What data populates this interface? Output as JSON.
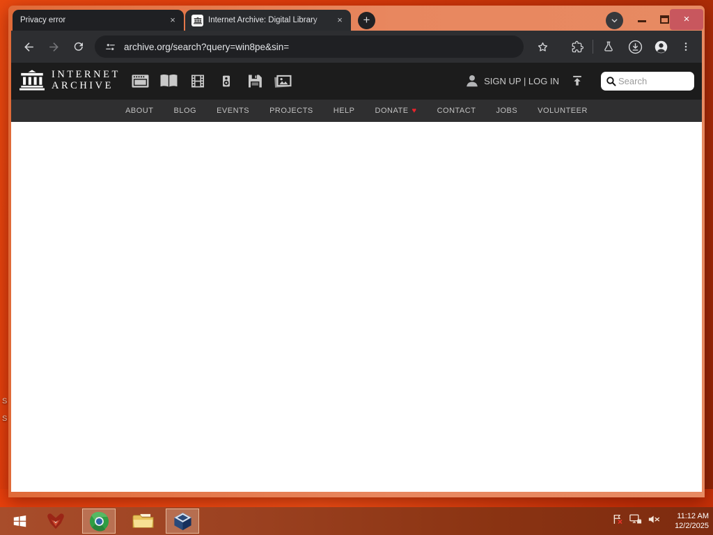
{
  "icons": {
    "close": "×",
    "plus": "+",
    "heart": "♥"
  },
  "browser": {
    "tabs": [
      {
        "title": "Privacy error"
      },
      {
        "title": "Internet Archive: Digital Library"
      }
    ],
    "url": "archive.org/search?query=win8pe&sin="
  },
  "archive_page": {
    "logo_line1": "INTERNET",
    "logo_line2": "ARCHIVE",
    "account_text": "SIGN UP | LOG IN",
    "search_placeholder": "Search",
    "media_types": "web, texts, video, audio, software, images",
    "nav_items": [
      {
        "label": "ABOUT"
      },
      {
        "label": "BLOG"
      },
      {
        "label": "EVENTS"
      },
      {
        "label": "PROJECTS"
      },
      {
        "label": "HELP"
      },
      {
        "label": "DONATE"
      },
      {
        "label": "CONTACT"
      },
      {
        "label": "JOBS"
      },
      {
        "label": "VOLUNTEER"
      }
    ]
  },
  "taskbar": {
    "time": "11:12 AM",
    "date": "12/2/2025"
  },
  "desktop": {
    "fragment1": "S",
    "fragment2": "S"
  },
  "colors": {
    "window_frame": "#e8875f",
    "close_button": "#c8575e",
    "toolbar": "#2d2e31",
    "ia_header": "#1c1c1c",
    "ia_navbar": "#2f2f30",
    "donate_heart": "#e8242c",
    "taskbar": "#8a3312",
    "wallpaper": "#d93a0b"
  }
}
